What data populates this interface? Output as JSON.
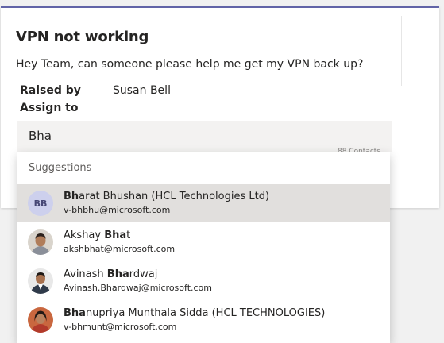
{
  "ticket": {
    "title": "VPN not working",
    "description": "Hey Team, can someone please help me get my VPN back up?",
    "raised_by_label": "Raised by",
    "raised_by_value": "Susan Bell",
    "assign_to_label": "Assign to"
  },
  "assign_input": {
    "value": "Bha",
    "char_counter": "88 Contacts"
  },
  "suggestions": {
    "header": "Suggestions",
    "items": [
      {
        "match": "Bh",
        "rest": "arat Bhushan (HCL Technologies Ltd)",
        "email": "v-bhbhu@microsoft.com",
        "initials": "BB"
      },
      {
        "pre": "Akshay ",
        "match": "Bha",
        "rest": "t",
        "email": "akshbhat@microsoft.com"
      },
      {
        "pre": "Avinash ",
        "match": "Bha",
        "rest": "rdwaj",
        "email": "Avinash.Bhardwaj@microsoft.com"
      },
      {
        "match": "Bha",
        "rest": "nupriya Munthala Sidda (HCL TECHNOLOGIES)",
        "email": "v-bhmunt@microsoft.com"
      }
    ]
  },
  "colors": {
    "accent": "#6264a7",
    "selected_row": "#e1dfdd",
    "initials_bg": "#cdd0ed"
  }
}
